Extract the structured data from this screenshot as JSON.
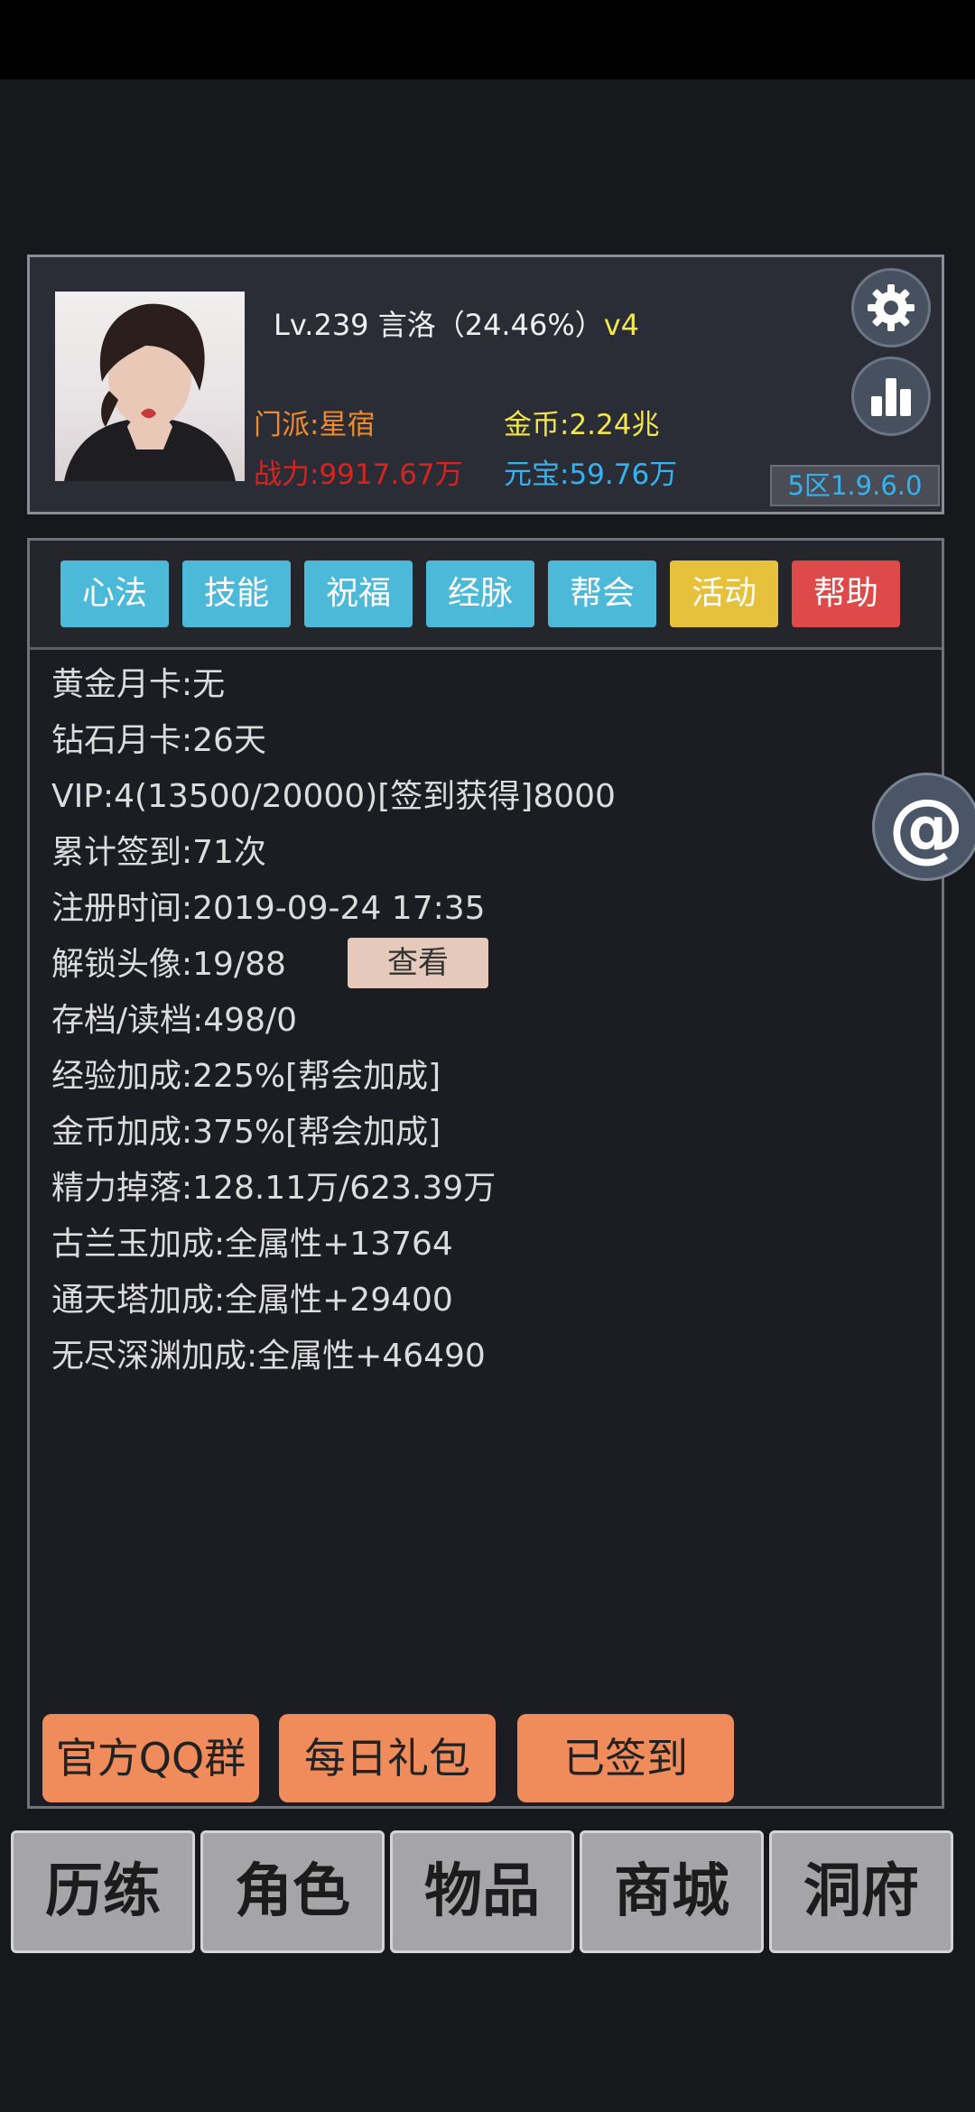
{
  "profile": {
    "level_line": "Lv.239 言洛（24.46%）",
    "vip_tag": "v4",
    "sect": "门派:星宿",
    "power": "战力:9917.67万",
    "gold": "金币:2.24兆",
    "ingot": "元宝:59.76万",
    "version": "5区1.9.6.0",
    "settings_icon": "gear-icon",
    "rank_icon": "bar-chart-icon"
  },
  "tabs": [
    {
      "label": "心法",
      "color": "#4cb9d9"
    },
    {
      "label": "技能",
      "color": "#4cb9d9"
    },
    {
      "label": "祝福",
      "color": "#4cb9d9"
    },
    {
      "label": "经脉",
      "color": "#4cb9d9"
    },
    {
      "label": "帮会",
      "color": "#4cb9d9"
    },
    {
      "label": "活动",
      "color": "#e6c13b"
    },
    {
      "label": "帮助",
      "color": "#dd4a49"
    }
  ],
  "info": [
    "黄金月卡:无",
    "钻石月卡:26天",
    "VIP:4(13500/20000)[签到获得]8000",
    "累计签到:71次",
    "注册时间:2019-09-24 17:35",
    "解锁头像:19/88",
    "存档/读档:498/0",
    "经验加成:225%[帮会加成]",
    "金币加成:375%[帮会加成]",
    "精力掉落:128.11万/623.39万",
    "古兰玉加成:全属性+13764",
    "通天塔加成:全属性+29400",
    "无尽深渊加成:全属性+46490"
  ],
  "view_button": "查看",
  "actions": {
    "qq_group": "官方QQ群",
    "daily_gift": "每日礼包",
    "signed_in": "已签到"
  },
  "nav": [
    "历练",
    "角色",
    "物品",
    "商城",
    "洞府"
  ],
  "floating": {
    "mention_icon": "@"
  }
}
